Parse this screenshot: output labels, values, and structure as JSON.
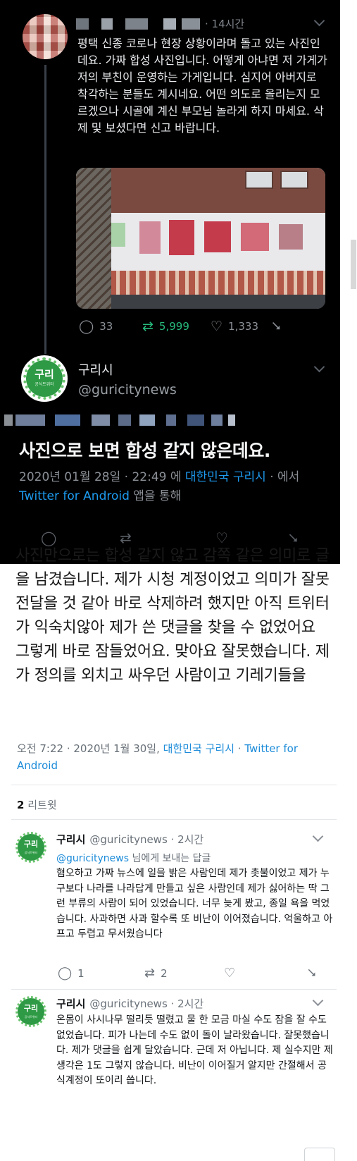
{
  "tweet1": {
    "time": "· 14시간",
    "text": "평택 신종 코로나 현장 상황이라며 돌고 있는 사진인데요. 가짜 합성 사진입니다. 어떻게 아냐면 저 가게가 저의 부친이 운영하는 가게입니다. 심지어 아버지로 착각하는 분들도 계시네요. 어떤 의도로 올리는지 모르겠으나 시골에 계신 부모님 놀라게 하지 마세요. 삭제 및 보셨다면 신고 바랍니다.",
    "replies": "33",
    "retweets": "5,999",
    "likes": "1,333",
    "icons": {
      "reply": "reply-icon",
      "retweet": "retweet-icon",
      "like": "heart-icon",
      "share": "share-icon"
    }
  },
  "account": {
    "name": "구리시",
    "handle": "@guricitynews",
    "logo_text": "구리",
    "logo_sub": "공식트위터",
    "logo_color": "#2e9a45"
  },
  "tweet2": {
    "text": "사진으로 보면 합성 같지 않은데요.",
    "meta_date": "2020년 01월 28일 · 22:49 에 ",
    "meta_location": "대한민국 구리시",
    "meta_mid": " · 에서 ",
    "meta_client": "Twitter for Android",
    "meta_end": " 앱을 통해"
  },
  "followup": {
    "text": "사진만으로는 합성 같지 않고 감쪽 같은 의미로 글을 남겼습니다. 제가 시청 계정이었고 의미가 잘못 전달을 것 같아 바로 삭제하려 했지만 아직 트위터가 익숙치않아 제가 쓴 댓글을 찾을 수 없었어요 그렇게 바로 잠들었어요. 맞아요 잘못했습니다. 제가 정의를 외치고 싸우던 사람이고 기레기들을",
    "meta_time": "오전 7:22 · 2020년 1월 30일, ",
    "meta_location": "대한민국 구리시",
    "meta_sep": " · ",
    "meta_client": "Twitter for Android",
    "retweet_count": "2",
    "retweet_label": "리트윗"
  },
  "replies": [
    {
      "name": "구리시",
      "handle": "@guricitynews",
      "time": "· 2시간",
      "to_handle": "@guricitynews",
      "to_suffix": " 님에게 보내는 답글",
      "text": "혐오하고 가짜 뉴스에 일을 밝은 사람인데 제가 촛불이었고 제가 누구보다 나라를 나라답게 만들고 싶은 사람인데 제가 싫어하는 딱 그런 부류의 사람이 되어 있었습니다. 너무 늦게 봤고, 종일 욕을 먹었습니다. 사과하면 사과 할수록 또 비난이 이어졌습니다. 억울하고 아프고 두렵고 무서웠습니다",
      "replies": "1",
      "retweets": "2"
    },
    {
      "name": "구리시",
      "handle": "@guricitynews",
      "time": "· 2시간",
      "text": "온몸이 사시나무 떨리듯 떨렸고 물 한 모금 마실 수도 잠을 잘 수도 없었습니다. 피가 나는데 수도 없이 돌이 날라왔습니다. 잘못했습니다. 제가 댓글을 쉽게 달았습니다. 근데 저 아닙니다. 제 실수지만 제 생각은 1도 그렇지 않습니다. 비난이 이어질거 알지만 간절해서 공식계정이 또이리 씁니다."
    }
  ]
}
